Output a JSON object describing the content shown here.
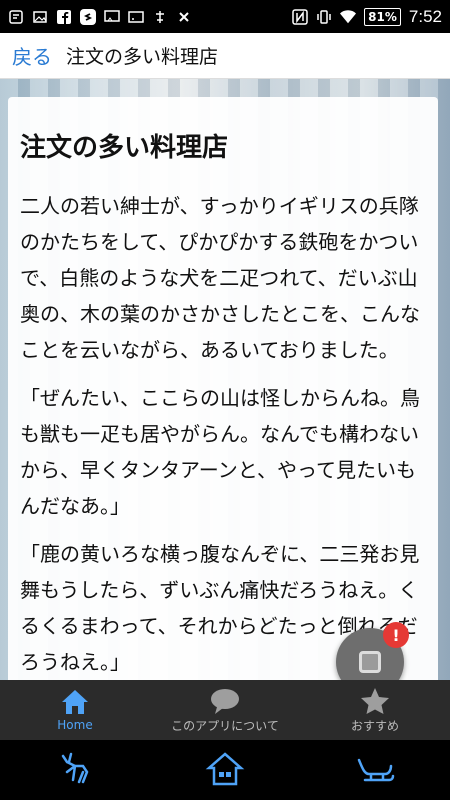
{
  "status_bar": {
    "battery": "81%",
    "time": "7:52",
    "icons": [
      "notification-icon",
      "photo-icon",
      "facebook-icon",
      "shazam-icon",
      "cast-icon",
      "tv-icon",
      "mute-icon",
      "no-sim-icon",
      "nfc-icon",
      "vibrate-icon",
      "wifi-icon"
    ]
  },
  "app_bar": {
    "back_label": "戻る",
    "title": "注文の多い料理店"
  },
  "story": {
    "title": "注文の多い料理店",
    "paragraphs": [
      "二人の若い紳士が、すっかりイギリスの兵隊のかたちをして、ぴかぴかする鉄砲をかついで、白熊のような犬を二疋つれて、だいぶ山奥の、木の葉のかさかさしたとこを、こんなことを云いながら、あるいておりました。",
      "「ぜんたい、ここらの山は怪しからんね。鳥も獣も一疋も居やがらん。なんでも構わないから、早くタンタアーンと、やって見たいもんだなあ。」",
      "「鹿の黄いろな横っ腹なんぞに、二三発お見舞もうしたら、ずいぶん痛快だろうねえ。くるくるまわって、それからどたっと倒れるだろうねえ。」"
    ]
  },
  "fab": {
    "badge": "!"
  },
  "tabs": [
    {
      "label": "Home",
      "icon": "home-icon",
      "active": true
    },
    {
      "label": "このアプリについて",
      "icon": "chat-bubble-icon",
      "active": false
    },
    {
      "label": "おすすめ",
      "icon": "star-icon",
      "active": false
    }
  ],
  "colors": {
    "accent": "#4fa3f7",
    "back_link": "#2a7bd3",
    "badge": "#e53935",
    "tabbar_bg": "#2b2b2b"
  }
}
